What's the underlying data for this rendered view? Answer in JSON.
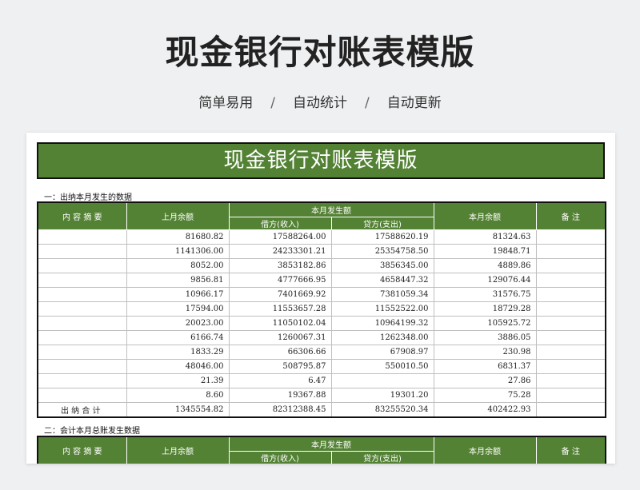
{
  "page": {
    "title": "现金银行对账表模版",
    "tags": [
      "简单易用",
      "自动统计",
      "自动更新"
    ],
    "separator": "/"
  },
  "sheet": {
    "title": "现金银行对账表模版",
    "section1_label": "一：出纳本月发生的数据",
    "section2_label": "二：会计本月总账发生数据",
    "headers": {
      "content": "内 容 摘 要",
      "last_balance": "上月余额",
      "month_amount": "本月发生额",
      "debit": "借方(收入)",
      "credit": "贷方(支出)",
      "this_balance": "本月余额",
      "remark": "备   注"
    },
    "rows": [
      {
        "last": "81680.82",
        "debit": "17588264.00",
        "credit": "17588620.19",
        "balance": "81324.63"
      },
      {
        "last": "1141306.00",
        "debit": "24233301.21",
        "credit": "25354758.50",
        "balance": "19848.71"
      },
      {
        "last": "8052.00",
        "debit": "3853182.86",
        "credit": "3856345.00",
        "balance": "4889.86"
      },
      {
        "last": "9856.81",
        "debit": "4777666.95",
        "credit": "4658447.32",
        "balance": "129076.44"
      },
      {
        "last": "10966.17",
        "debit": "7401669.92",
        "credit": "7381059.34",
        "balance": "31576.75"
      },
      {
        "last": "17594.00",
        "debit": "11553657.28",
        "credit": "11552522.00",
        "balance": "18729.28"
      },
      {
        "last": "20023.00",
        "debit": "11050102.04",
        "credit": "10964199.32",
        "balance": "105925.72"
      },
      {
        "last": "6166.74",
        "debit": "1260067.31",
        "credit": "1262348.00",
        "balance": "3886.05"
      },
      {
        "last": "1833.29",
        "debit": "66306.66",
        "credit": "67908.97",
        "balance": "230.98"
      },
      {
        "last": "48046.00",
        "debit": "508795.87",
        "credit": "550010.50",
        "balance": "6831.37"
      },
      {
        "last": "21.39",
        "debit": "6.47",
        "credit": "",
        "balance": "27.86"
      },
      {
        "last": "8.60",
        "debit": "19367.88",
        "credit": "19301.20",
        "balance": "75.28"
      }
    ],
    "total": {
      "label": "出 纳 合 计",
      "last": "1345554.82",
      "debit": "82312388.45",
      "credit": "83255520.34",
      "balance": "402422.93"
    }
  }
}
